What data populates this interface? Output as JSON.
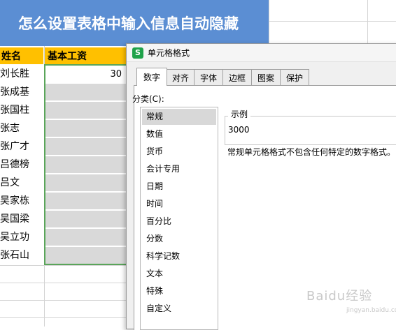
{
  "sheet": {
    "title": "怎么设置表格中输入信息自动隐藏",
    "headers": {
      "name": "姓名",
      "salary": "基本工资"
    },
    "names": [
      "刘长胜",
      "张成基",
      "张国柱",
      "张志",
      "张广才",
      "吕德榜",
      "吕文",
      "吴家栋",
      "吴国梁",
      "吴立功",
      "张石山"
    ],
    "first_salary_visible": "30",
    "colors": {
      "title_band": "#5b8ed3",
      "header": "#ffc000",
      "hidden_cells": "#d9d9d9",
      "selection": "#5aa55a"
    }
  },
  "dialog": {
    "icon_letter": "S",
    "title": "单元格格式",
    "tabs": [
      "数字",
      "对齐",
      "字体",
      "边框",
      "图案",
      "保护"
    ],
    "active_tab": "数字",
    "category_label": "分类(C):",
    "categories": [
      "常规",
      "数值",
      "货币",
      "会计专用",
      "日期",
      "时间",
      "百分比",
      "分数",
      "科学记数",
      "文本",
      "特殊",
      "自定义"
    ],
    "selected_category": "常规",
    "sample_label": "示例",
    "sample_value": "3000",
    "description": "常规单元格格式不包含任何特定的数字格式。"
  },
  "watermark": {
    "text": "Baidu经验",
    "sub": "jingyan.baidu.com"
  }
}
